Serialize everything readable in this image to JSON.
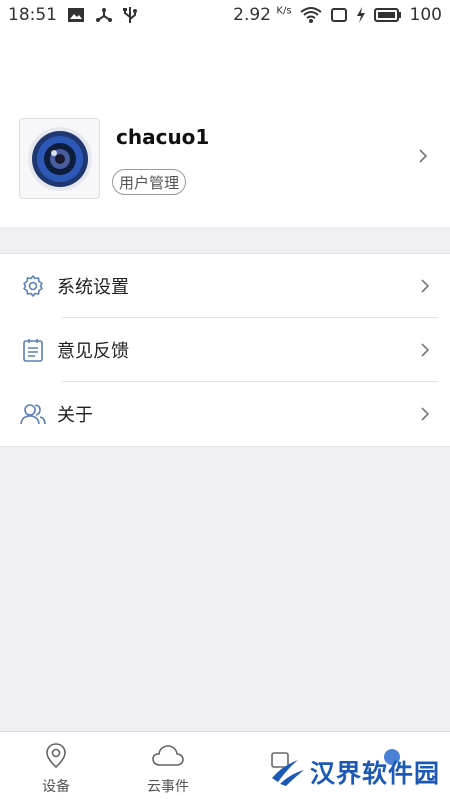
{
  "status_bar": {
    "time": "18:51",
    "net_speed_value": "2.92",
    "net_speed_unit": "K/s",
    "battery_level": "100"
  },
  "profile": {
    "username": "chacuo1",
    "user_management_label": "用户管理"
  },
  "menu": {
    "items": [
      {
        "label": "系统设置",
        "icon": "gear-icon"
      },
      {
        "label": "意见反馈",
        "icon": "clipboard-icon"
      },
      {
        "label": "关于",
        "icon": "users-icon"
      }
    ]
  },
  "tabbar": {
    "tabs": [
      {
        "label": "设备",
        "icon": "location-pin-icon"
      },
      {
        "label": "云事件",
        "icon": "cloud-icon"
      }
    ]
  },
  "watermark": {
    "text": "汉界软件园"
  },
  "colors": {
    "accent": "#1c58b6",
    "icon_blue": "#5b7fb5",
    "background": "#efeef3"
  }
}
